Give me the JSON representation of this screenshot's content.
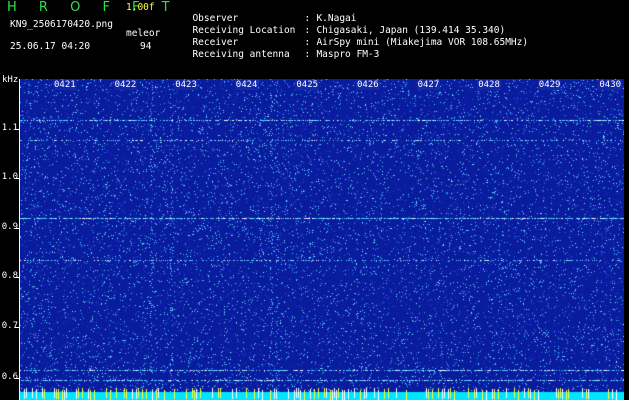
{
  "header": {
    "app_name": "HROFFT",
    "version": "1.00f",
    "filename": "KN9_2506170420.png",
    "mode": "meleor",
    "timestamp": "25.06.17 04:20",
    "count": "94"
  },
  "station_info": [
    {
      "label": "Observer",
      "value": "K.Nagai"
    },
    {
      "label": "Receiving Location",
      "value": "Chigasaki, Japan (139.414 35.340)"
    },
    {
      "label": "Receiver",
      "value": "AirSpy mini (Miakejima VOR 108.65MHz)"
    },
    {
      "label": "Receiving antenna",
      "value": "Maspro FM-3"
    }
  ],
  "spectrogram": {
    "y_unit": "kHz",
    "y_ticks": [
      "1.1",
      "1.0",
      "0.9",
      "0.8",
      "0.7",
      "0.6"
    ],
    "x_ticks": [
      "0421",
      "0422",
      "0423",
      "0424",
      "0425",
      "0426",
      "0427",
      "0428",
      "0429",
      "0430"
    ],
    "colors": {
      "background": "#0a1c9e",
      "dots": "#4fd0ff",
      "bright": "#ffffff",
      "baseline": "#00e5ff",
      "baseline_spikes": "#ffff30"
    }
  }
}
